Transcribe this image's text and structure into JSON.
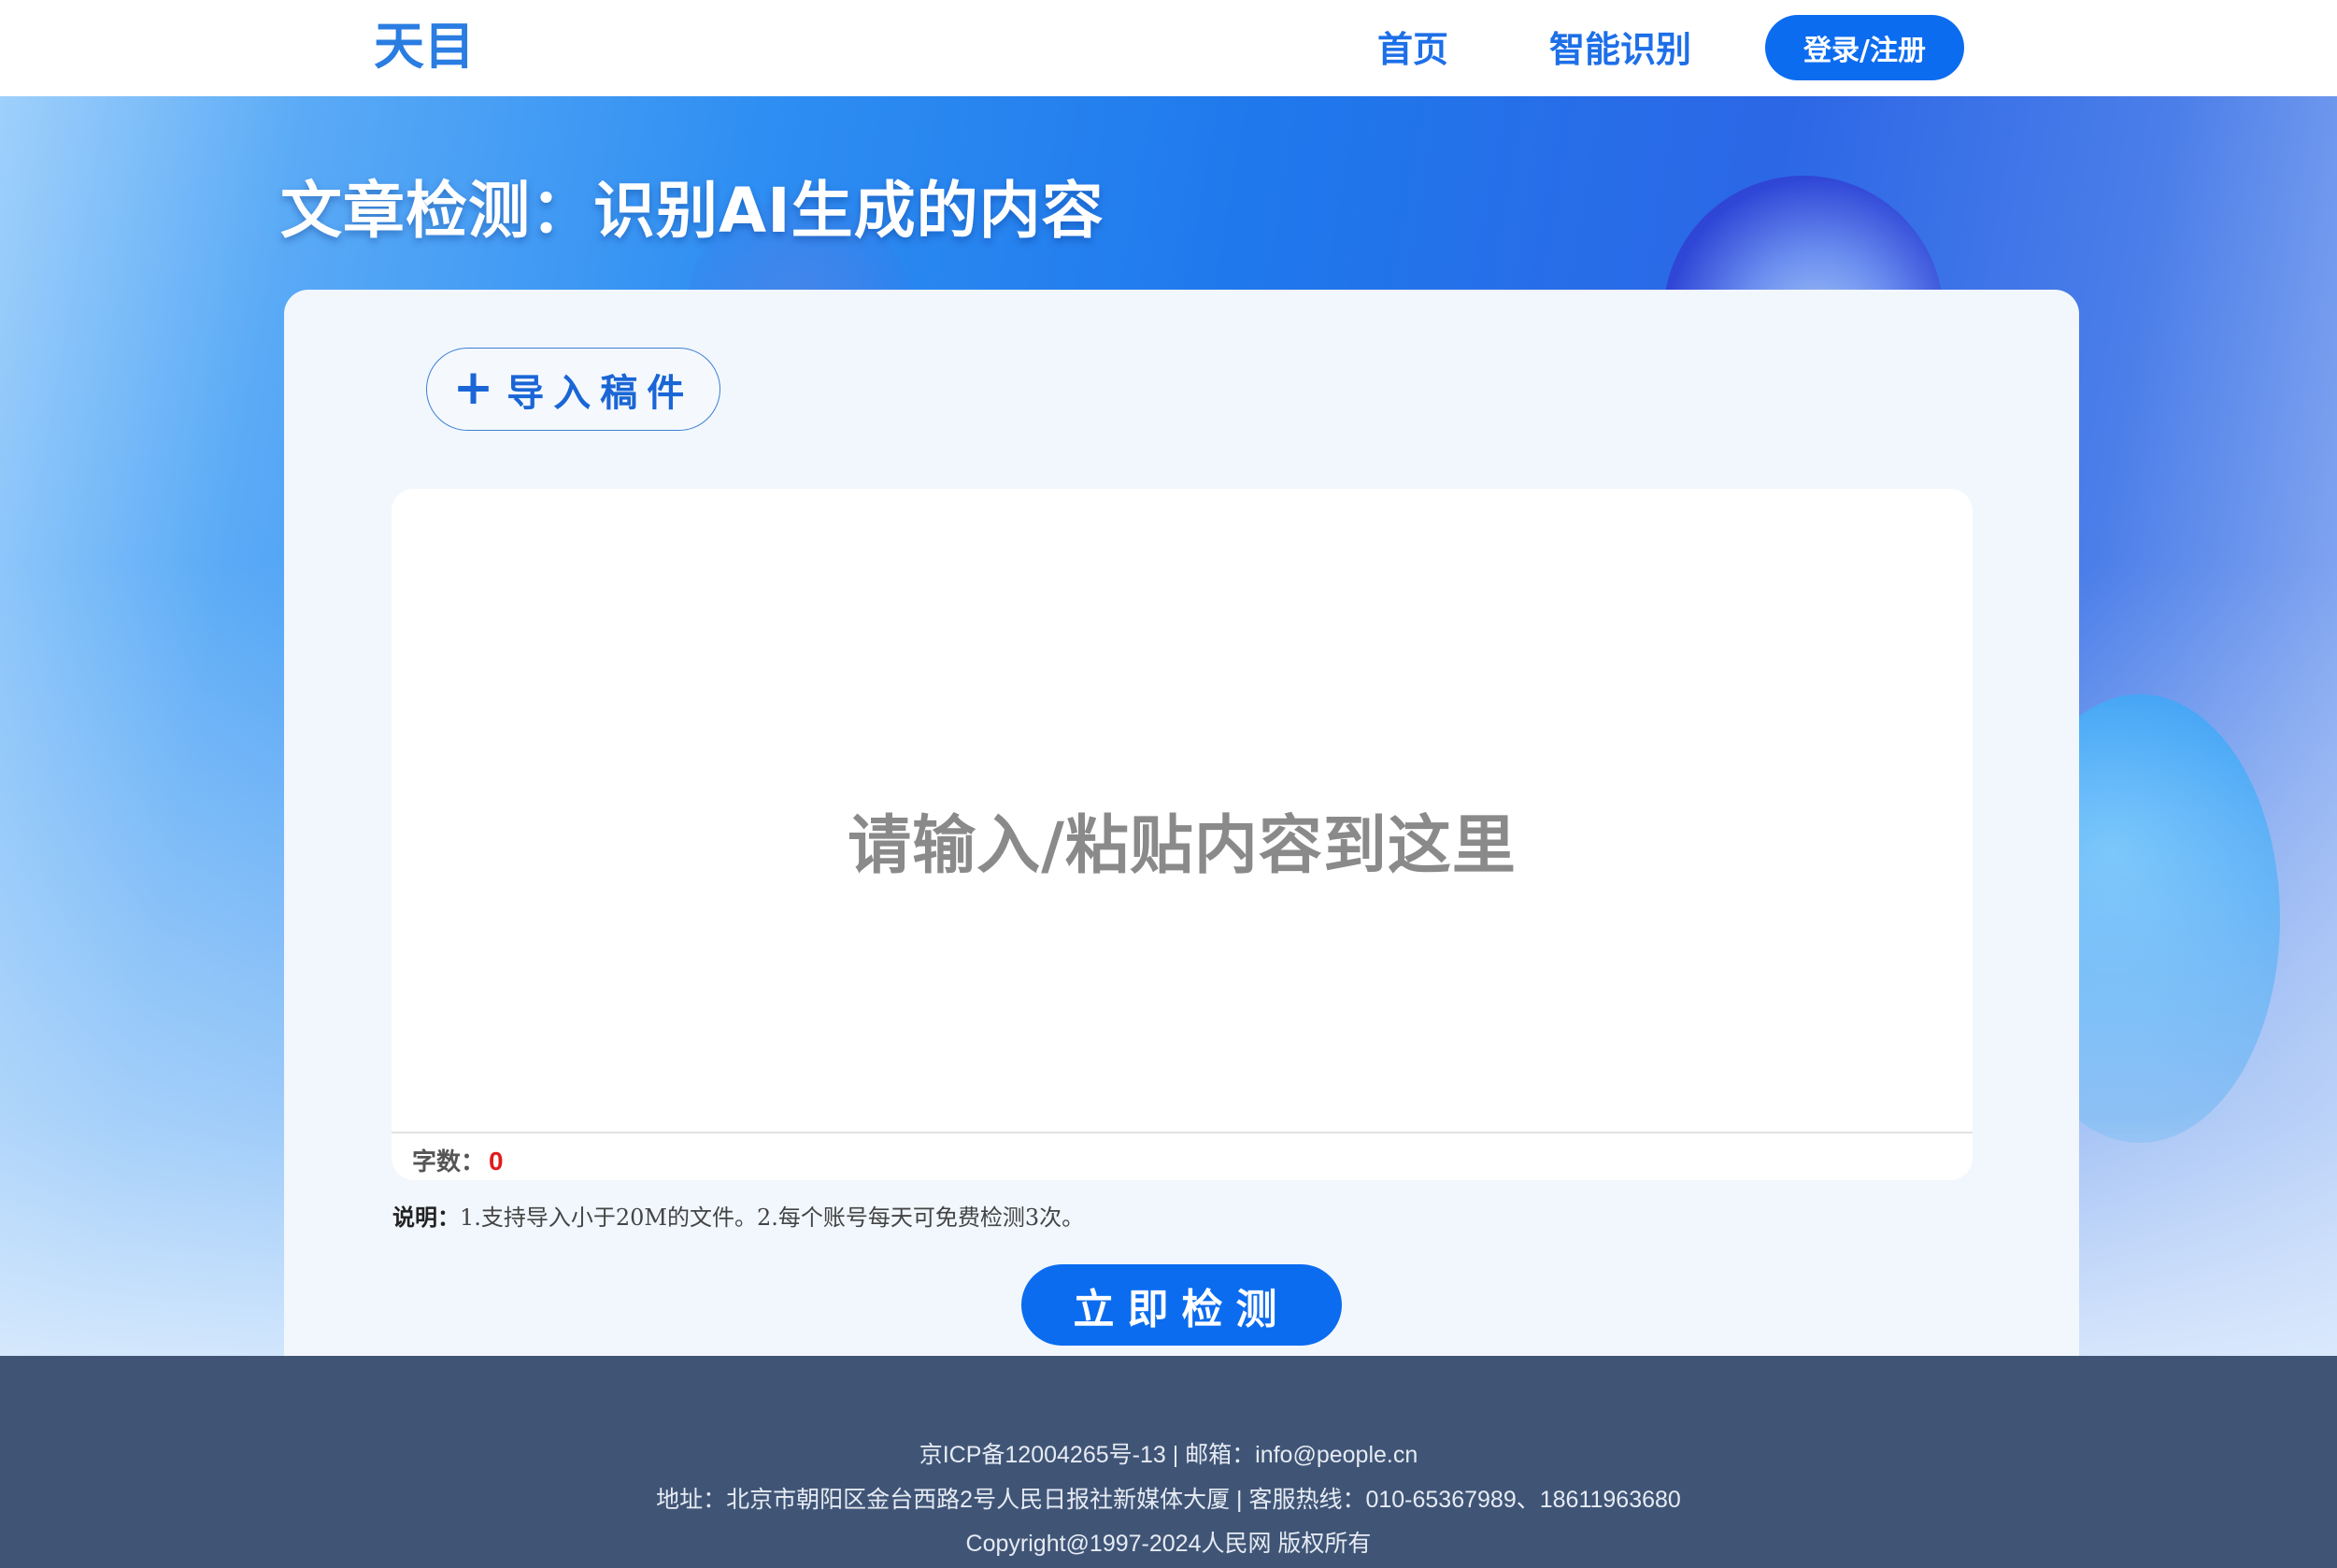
{
  "header": {
    "logo_text": "天目",
    "nav": [
      {
        "label": "首页"
      },
      {
        "label": "智能识别"
      }
    ],
    "login_label": "登录/注册"
  },
  "hero": {
    "title": "文章检测：识别AI生成的内容"
  },
  "card": {
    "import_label": "导入稿件",
    "editor_placeholder": "请输入/粘贴内容到这里",
    "word_count_label": "字数：",
    "word_count_value": "0",
    "note_label": "说明：",
    "note_text": "1.支持导入小于20M的文件。2.每个账号每天可免费检测3次。",
    "detect_label": "立即检测"
  },
  "footer": {
    "line1": "京ICP备12004265号-13 | 邮箱：info@people.cn",
    "line2": "地址：北京市朝阳区金台西路2号人民日报社新媒体大厦 | 客服热线：010-65367989、18611963680",
    "line3": "Copyright@1997-2024人民网 版权所有"
  },
  "icons": {
    "import_icon": "plus-icon"
  },
  "colors": {
    "primary": "#0b6cf0",
    "footer_bg": "#405576",
    "count_value": "#e21b1b"
  }
}
